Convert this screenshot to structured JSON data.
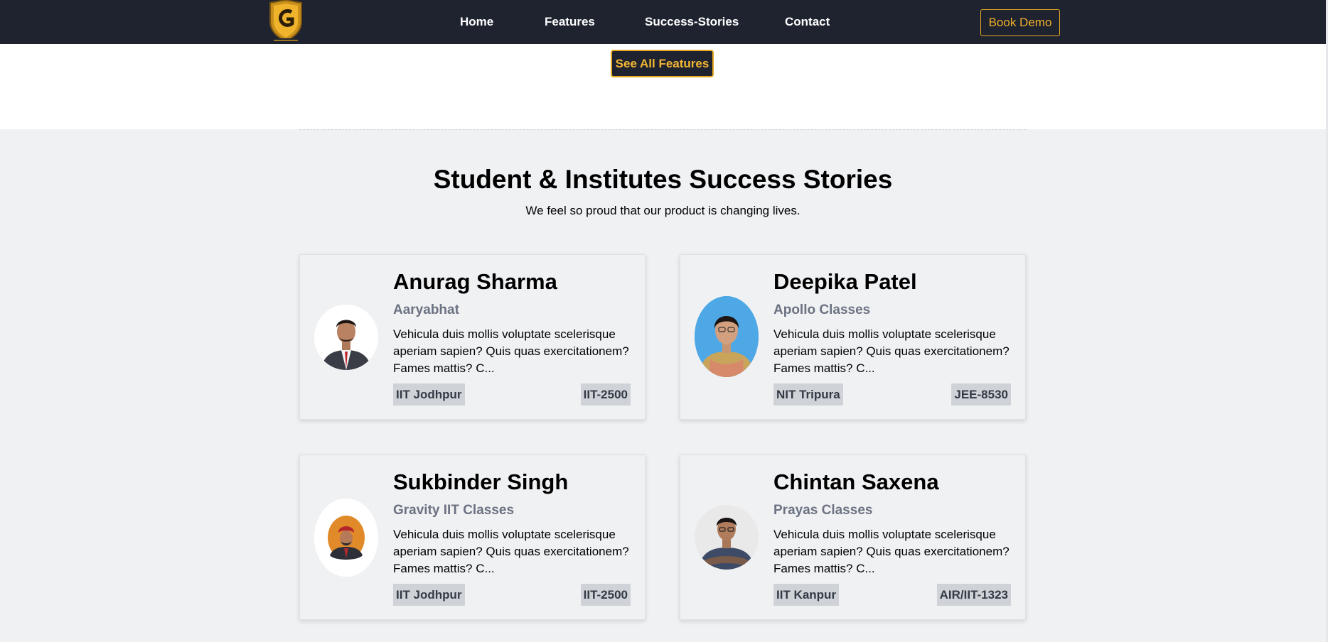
{
  "nav": {
    "links": [
      "Home",
      "Features",
      "Success-Stories",
      "Contact"
    ],
    "cta": "Book Demo"
  },
  "features": {
    "see_all_label": "See All Features"
  },
  "stories": {
    "title": "Student & Institutes Success Stories",
    "subtitle": "We feel so proud that our product is changing lives.",
    "cards": [
      {
        "name": "Anurag Sharma",
        "institute": "Aaryabhat",
        "text": "Vehicula duis mollis voluptate scelerisque aperiam sapien? Quis quas exercitationem? Fames mattis? C...",
        "college": "IIT Jodhpur",
        "rank": "IIT-2500"
      },
      {
        "name": "Deepika Patel",
        "institute": "Apollo Classes",
        "text": "Vehicula duis mollis voluptate scelerisque aperiam sapien? Quis quas exercitationem? Fames mattis? C...",
        "college": "NIT Tripura",
        "rank": "JEE-8530"
      },
      {
        "name": "Sukbinder Singh",
        "institute": "Gravity IIT Classes",
        "text": "Vehicula duis mollis voluptate scelerisque aperiam sapien? Quis quas exercitationem? Fames mattis? C...",
        "college": "IIT Jodhpur",
        "rank": "IIT-2500"
      },
      {
        "name": "Chintan Saxena",
        "institute": "Prayas Classes",
        "text": "Vehicula duis mollis voluptate scelerisque aperiam sapien? Quis quas exercitationem? Fames mattis? C...",
        "college": "IIT Kanpur",
        "rank": "AIR/IIT-1323"
      }
    ]
  },
  "colors": {
    "navbar": "#1f2330",
    "accent": "#f2b02a",
    "section_bg": "#f0f1f3",
    "tag_bg": "#cfd3d8",
    "institute_text": "#6c7282"
  }
}
